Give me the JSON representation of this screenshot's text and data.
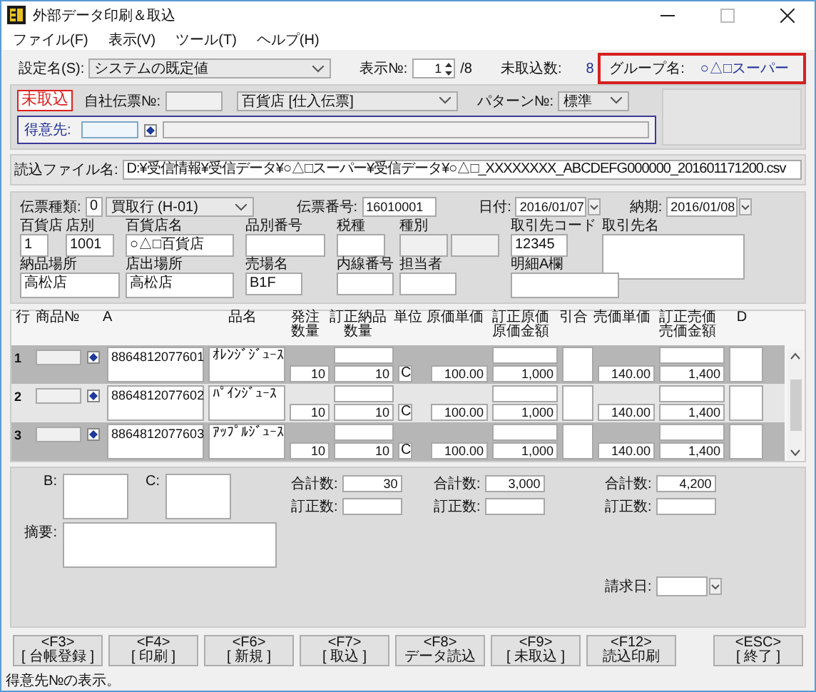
{
  "window": {
    "title": "外部データ印刷＆取込"
  },
  "menu": [
    {
      "label": "ファイル(F)"
    },
    {
      "label": "表示(V)"
    },
    {
      "label": "ツール(T)"
    },
    {
      "label": "ヘルプ(H)"
    }
  ],
  "header": {
    "setting_label": "設定名(S):",
    "setting_value": "システムの既定値",
    "display_label": "表示№:",
    "display_value": "1",
    "display_total": "/8",
    "pending_label": "未取込数:",
    "pending_value": "8",
    "group_label": "グループ名:",
    "group_value": "○△□スーパー"
  },
  "import_panel": {
    "status": "未取込",
    "own_slip_label": "自社伝票№:",
    "slip_format": "百貨店 [仕入伝票]",
    "pattern_label": "パターン№:",
    "pattern_value": "標準",
    "customer_label": "得意先:"
  },
  "file": {
    "label": "読込ファイル名:",
    "value": "D:¥受信情報¥受信データ¥○△□スーパー¥受信データ¥○△□_XXXXXXXX_ABCDEFG000000_201601171200.csv"
  },
  "slip": {
    "type_label": "伝票種類:",
    "type_code": "0",
    "type_value": "買取行 (H-01)",
    "number_label": "伝票番号:",
    "number_value": "16010001",
    "date_label": "日付:",
    "date_value": "2016/01/07",
    "due_label": "納期:",
    "due_value": "2016/01/08",
    "fields": [
      {
        "label": "百貨店",
        "value": "1"
      },
      {
        "label": "店別",
        "value": "1001"
      },
      {
        "label": "百貨店名",
        "value": "○△□百貨店"
      },
      {
        "label": "品別番号"
      },
      {
        "label": "税種"
      },
      {
        "label": "種別"
      },
      {
        "label": "取引先コード",
        "value": "12345"
      },
      {
        "label": "取引先名"
      },
      {
        "label": "納品場所",
        "value": "高松店"
      },
      {
        "label": "店出場所",
        "value": "高松店"
      },
      {
        "label": "売場名",
        "value": "B1F"
      },
      {
        "label": "内線番号"
      },
      {
        "label": "担当者"
      },
      {
        "label": "明細A欄"
      }
    ]
  },
  "table": {
    "columns": [
      "行",
      "商品№",
      "A",
      "品名",
      "発注数量",
      "訂正納品数量",
      "単位",
      "原価単価",
      "訂正原価原価金額",
      "引合",
      "売価単価",
      "訂正売価売価金額",
      "D"
    ],
    "rows": [
      {
        "no": "1",
        "shaded": true,
        "item": "8864812077601",
        "name": "ｵﾚﾝｼﾞｼﾞｭｰｽ",
        "order_qty": "10",
        "delivered_qty": "10",
        "unit": "C",
        "unit_cost": "100.00",
        "cost_amount": "1,000",
        "unit_price": "140.00",
        "price_amount": "1,400"
      },
      {
        "no": "2",
        "shaded": false,
        "item": "8864812077602",
        "name": "ﾊﾟｲﾝｼﾞｭｰｽ",
        "order_qty": "10",
        "delivered_qty": "10",
        "unit": "C",
        "unit_cost": "100.00",
        "cost_amount": "1,000",
        "unit_price": "140.00",
        "price_amount": "1,400"
      },
      {
        "no": "3",
        "shaded": true,
        "item": "8864812077603",
        "name": "ｱｯﾌﾟﾙｼﾞｭｰｽ",
        "order_qty": "10",
        "delivered_qty": "10",
        "unit": "C",
        "unit_cost": "100.00",
        "cost_amount": "1,000",
        "unit_price": "140.00",
        "price_amount": "1,400"
      }
    ]
  },
  "totals": {
    "b_label": "B:",
    "c_label": "C:",
    "memo_label": "摘要:",
    "billing_label": "請求日:",
    "groups": [
      {
        "total_label": "合計数:",
        "total_value": "30",
        "corrected_label": "訂正数:"
      },
      {
        "total_label": "合計数:",
        "total_value": "3,000",
        "corrected_label": "訂正数:"
      },
      {
        "total_label": "合計数:",
        "total_value": "4,200",
        "corrected_label": "訂正数:"
      }
    ]
  },
  "buttons": [
    {
      "key": "<F3>",
      "label": "[ 台帳登録 ]"
    },
    {
      "key": "<F4>",
      "label": "[ 印刷 ]"
    },
    {
      "key": "<F6>",
      "label": "[ 新規 ]"
    },
    {
      "key": "<F7>",
      "label": "[ 取込 ]"
    },
    {
      "key": "<F8>",
      "label": "データ読込"
    },
    {
      "key": "<F9>",
      "label": "[ 未取込 ]"
    },
    {
      "key": "<F12>",
      "label": "読込印刷"
    },
    {
      "key": "<ESC>",
      "label": "[ 終了 ]"
    }
  ],
  "status_bar": "得意先№の表示。"
}
